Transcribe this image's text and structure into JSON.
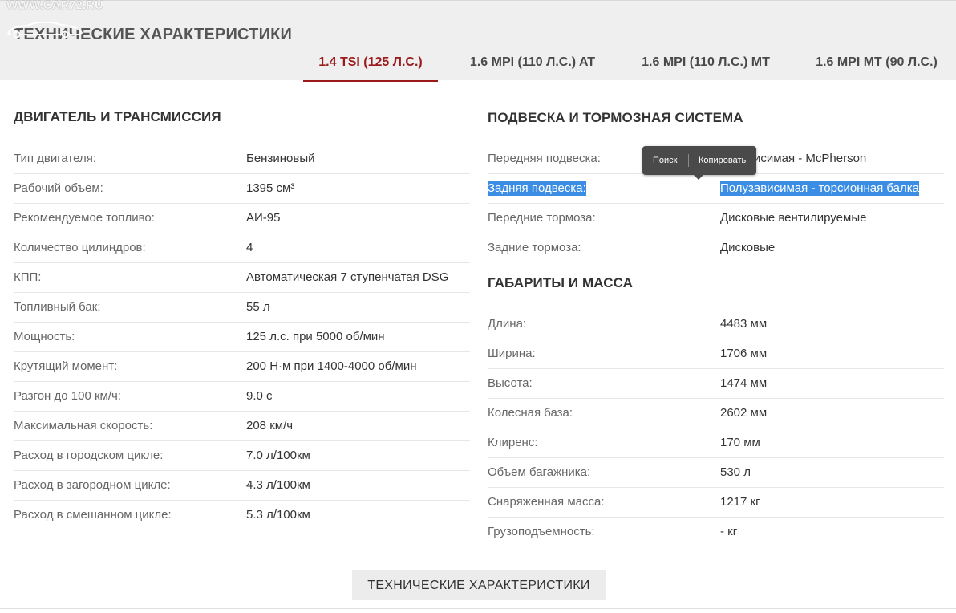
{
  "watermark": "WWW.CAR72.RU",
  "header": {
    "title": "ТЕХНИЧЕСКИЕ ХАРАКТЕРИСТИКИ",
    "tabs": [
      {
        "label": "1.4 TSI (125 Л.С.)",
        "active": true
      },
      {
        "label": "1.6 MPI (110 Л.С.) AT",
        "active": false
      },
      {
        "label": "1.6 MPI (110 Л.С.) MT",
        "active": false
      },
      {
        "label": "1.6 MPI MT (90 Л.С.)",
        "active": false
      }
    ]
  },
  "engine": {
    "title": "ДВИГАТЕЛЬ И ТРАНСМИССИЯ",
    "rows": [
      {
        "label": "Тип двигателя:",
        "value": "Бензиновый"
      },
      {
        "label": "Рабочий объем:",
        "value": "1395 см³"
      },
      {
        "label": "Рекомендуемое топливо:",
        "value": "АИ-95"
      },
      {
        "label": "Количество цилиндров:",
        "value": "4"
      },
      {
        "label": "КПП:",
        "value": "Автоматическая 7 ступенчатая DSG"
      },
      {
        "label": "Топливный бак:",
        "value": "55 л"
      },
      {
        "label": "Мощность:",
        "value": "125 л.с. при 5000 об/мин"
      },
      {
        "label": "Крутящий момент:",
        "value": "200 Н·м при 1400-4000 об/мин"
      },
      {
        "label": "Разгон до 100 км/ч:",
        "value": "9.0 с"
      },
      {
        "label": "Максимальная скорость:",
        "value": "208 км/ч"
      },
      {
        "label": "Расход в городском цикле:",
        "value": "7.0 л/100км"
      },
      {
        "label": "Расход в загородном цикле:",
        "value": "4.3 л/100км"
      },
      {
        "label": "Расход в смешанном цикле:",
        "value": "5.3 л/100км"
      }
    ]
  },
  "suspension": {
    "title": "ПОДВЕСКА И ТОРМОЗНАЯ СИСТЕМА",
    "rows": [
      {
        "label": "Передняя подвеска:",
        "value": "Независимая - McPherson"
      },
      {
        "label": "Задняя подвеска:",
        "value": "Полузависимая - торсионная балка"
      },
      {
        "label": "Передние тормоза:",
        "value": "Дисковые вентилируемые"
      },
      {
        "label": "Задние тормоза:",
        "value": "Дисковые"
      }
    ]
  },
  "dimensions": {
    "title": "ГАБАРИТЫ И МАССА",
    "rows": [
      {
        "label": "Длина:",
        "value": "4483 мм"
      },
      {
        "label": "Ширина:",
        "value": "1706 мм"
      },
      {
        "label": "Высота:",
        "value": "1474 мм"
      },
      {
        "label": "Колесная база:",
        "value": "2602 мм"
      },
      {
        "label": "Клиренс:",
        "value": "170 мм"
      },
      {
        "label": "Объем багажника:",
        "value": "530 л"
      },
      {
        "label": "Снаряженная масса:",
        "value": "1217 кг"
      },
      {
        "label": "Грузоподъемность:",
        "value": "- кг"
      }
    ]
  },
  "context_menu": {
    "search": "Поиск",
    "copy": "Копировать"
  },
  "footer": {
    "button_label": "ТЕХНИЧЕСКИЕ ХАРАКТЕРИСТИКИ"
  },
  "colors": {
    "accent": "#9b1b1b",
    "selection": "#3b8ee3",
    "header_bg": "#efefef"
  }
}
